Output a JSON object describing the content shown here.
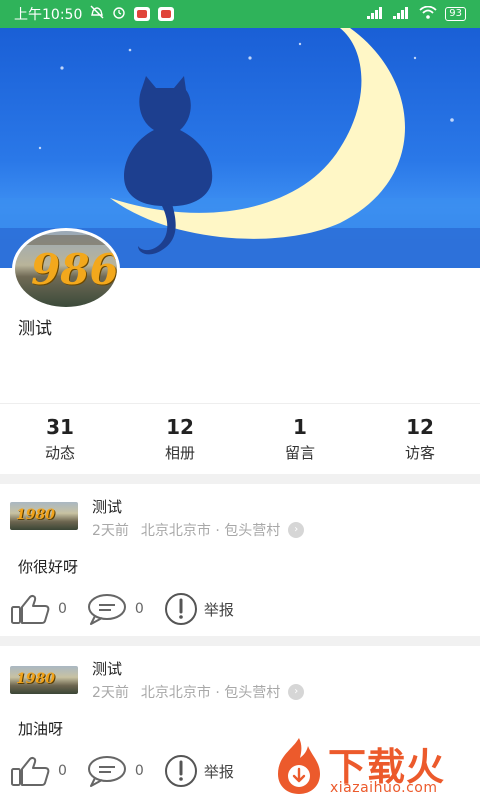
{
  "status_bar": {
    "time": "上午10:50",
    "battery": "93"
  },
  "profile": {
    "avatar_text": "986",
    "username": "测试"
  },
  "stats": [
    {
      "value": "31",
      "label": "动态"
    },
    {
      "value": "12",
      "label": "相册"
    },
    {
      "value": "1",
      "label": "留言"
    },
    {
      "value": "12",
      "label": "访客"
    }
  ],
  "posts": [
    {
      "thumb_text": "1980",
      "name": "测试",
      "time": "2天前",
      "location": "北京北京市 · 包头营村",
      "content": "你很好呀",
      "likes": "0",
      "comments": "0",
      "report_label": "举报"
    },
    {
      "thumb_text": "1980",
      "name": "测试",
      "time": "2天前",
      "location": "北京北京市 · 包头营村",
      "content": "加油呀",
      "likes": "0",
      "comments": "0",
      "report_label": "举报"
    }
  ],
  "watermark": {
    "text": "下载火",
    "sub": "xiazaihuo.com"
  },
  "colors": {
    "status_bar": "#2fb35a",
    "sky": "#2a78e8",
    "moon": "#fff7c6",
    "cat": "#1d3f8f",
    "watermark": "#ec5a2c"
  }
}
